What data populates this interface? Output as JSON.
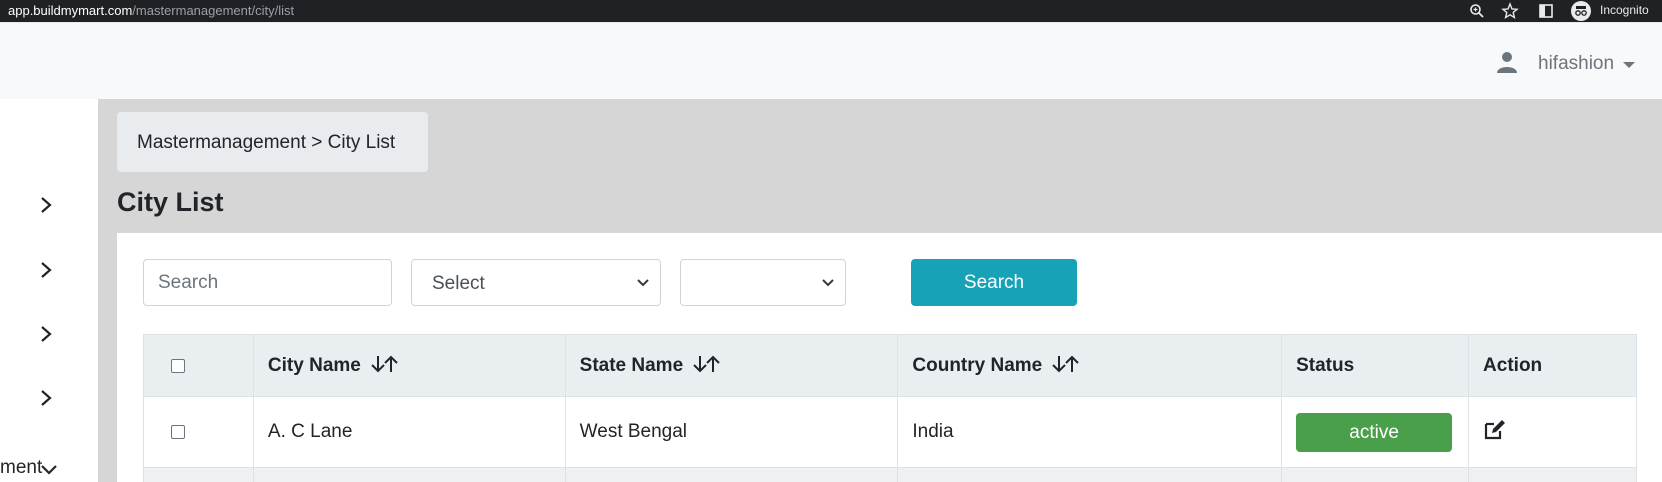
{
  "browser": {
    "url_host": "app.buildmymart.com",
    "url_path": "/mastermanagement/city/list",
    "incognito_label": "Incognito",
    "icons": [
      "zoom-icon",
      "star-icon",
      "sidepanel-icon",
      "incognito-icon"
    ]
  },
  "navbar": {
    "user_name": "hifashion",
    "icons": [
      "user-icon",
      "caret-down-icon"
    ]
  },
  "sidebar": {
    "items": [
      {
        "icon": "chevron-right-icon"
      },
      {
        "icon": "chevron-right-icon"
      },
      {
        "icon": "chevron-right-icon"
      },
      {
        "icon": "chevron-right-icon"
      }
    ],
    "partial_label": "ment",
    "partial_icon": "chevron-down-icon"
  },
  "breadcrumb": "Mastermanagement > City List",
  "page_title": "City List",
  "filters": {
    "search_placeholder": "Search",
    "select1_value": "Select",
    "select2_value": "",
    "search_button": "Search"
  },
  "table": {
    "headers": {
      "city": "City Name",
      "state": "State Name",
      "country": "Country Name",
      "status": "Status",
      "action": "Action"
    },
    "rows": [
      {
        "city": "A. C Lane",
        "state": "West Bengal",
        "country": "India",
        "status": "active"
      }
    ]
  },
  "colors": {
    "accent": "#17a2b8",
    "active_badge": "#4aa04a",
    "content_bg": "#d6d6d6"
  }
}
